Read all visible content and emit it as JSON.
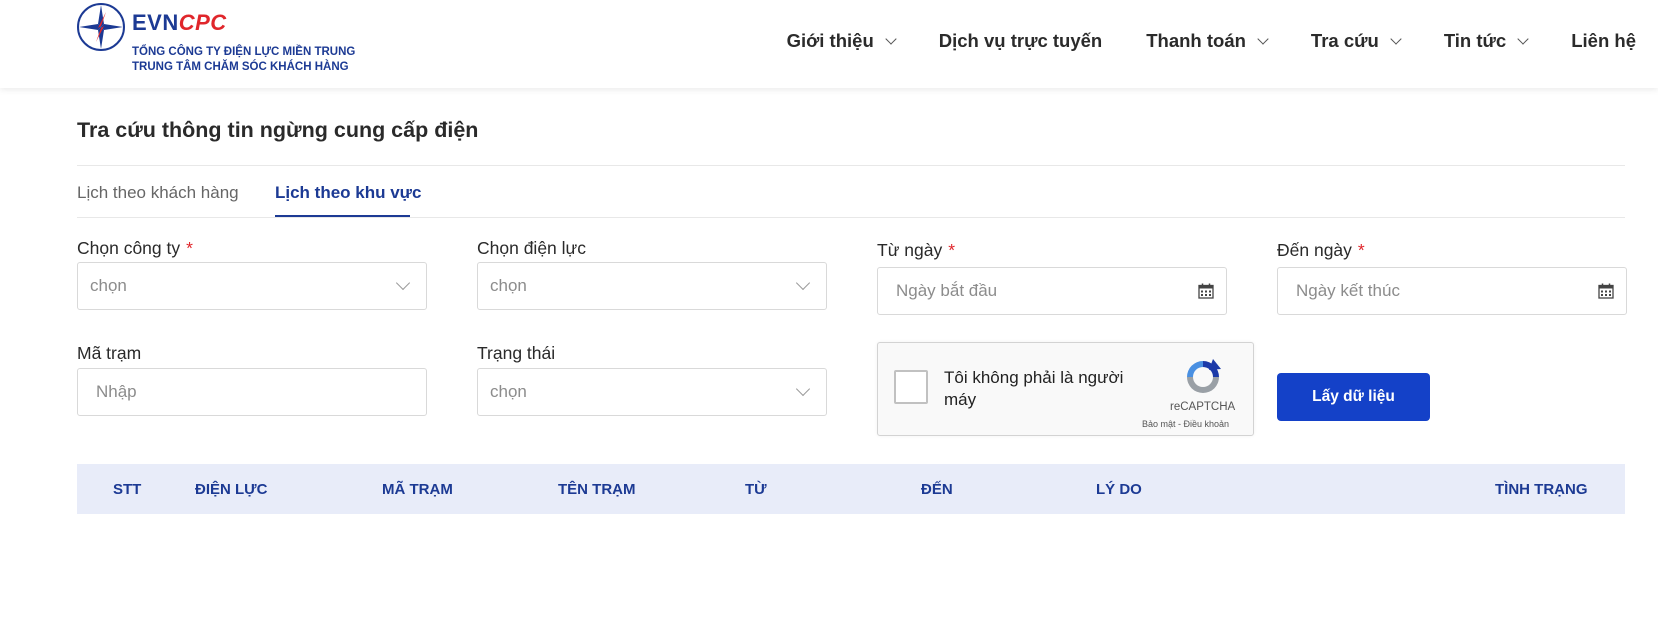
{
  "header": {
    "brand_evn": "EVN",
    "brand_cpc": "CPC",
    "subtitle_1": "TỔNG CÔNG TY ĐIỆN LỰC MIỀN TRUNG",
    "subtitle_2": "TRUNG TÂM CHĂM SÓC KHÁCH HÀNG",
    "nav": [
      {
        "label": "Giới thiệu",
        "dropdown": true
      },
      {
        "label": "Dịch vụ trực tuyến",
        "dropdown": false
      },
      {
        "label": "Thanh toán",
        "dropdown": true
      },
      {
        "label": "Tra cứu",
        "dropdown": true
      },
      {
        "label": "Tin tức",
        "dropdown": true
      },
      {
        "label": "Liên hệ",
        "dropdown": false
      }
    ]
  },
  "page": {
    "title": "Tra cứu thông tin ngừng cung cấp điện",
    "tabs": [
      {
        "label": "Lịch theo khách hàng",
        "active": false
      },
      {
        "label": "Lịch theo khu vực",
        "active": true
      }
    ]
  },
  "form": {
    "company": {
      "label": "Chọn công ty",
      "required": "*",
      "placeholder": "chọn"
    },
    "power_unit": {
      "label": "Chọn điện lực",
      "placeholder": "chọn"
    },
    "from_date": {
      "label": "Từ ngày",
      "required": "*",
      "placeholder": "Ngày bắt đầu"
    },
    "to_date": {
      "label": "Đến ngày",
      "required": "*",
      "placeholder": "Ngày kết thúc"
    },
    "station_code": {
      "label": "Mã trạm",
      "placeholder": "Nhập"
    },
    "status": {
      "label": "Trạng thái",
      "placeholder": "chọn"
    },
    "captcha": {
      "text": "Tôi không phải là người máy",
      "brand": "reCAPTCHA",
      "links": "Bảo mật - Điều khoản"
    },
    "submit_label": "Lấy dữ liệu"
  },
  "table": {
    "columns": [
      "STT",
      "ĐIỆN LỰC",
      "MÃ TRẠM",
      "TÊN TRẠM",
      "TỪ",
      "ĐẾN",
      "LÝ DO",
      "TÌNH TRẠNG"
    ]
  },
  "colors": {
    "brand_blue": "#1c3a94",
    "brand_red": "#e0262b",
    "button_blue": "#1441c8",
    "table_header_bg": "#e8ecf9"
  }
}
